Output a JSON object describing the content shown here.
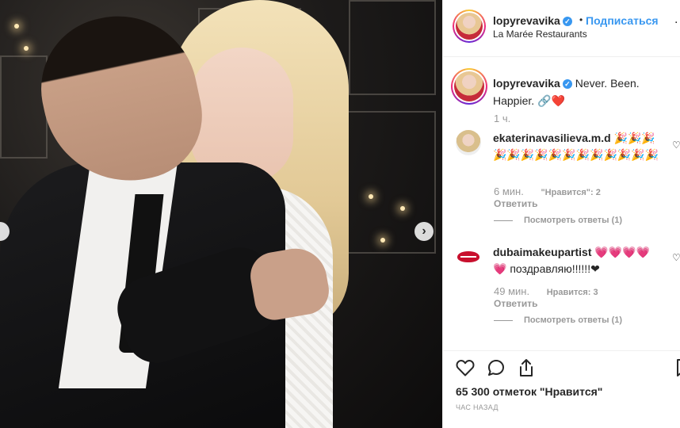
{
  "post": {
    "author": "lopyrevavika",
    "follow_label": "Подписаться",
    "separator": "•",
    "more_label": ".",
    "location": "La Marée Restaurants",
    "caption": "Never. Been. Happier. 🔗❤️",
    "caption_time": "1 ч.",
    "likes": "65 300 отметок \"Нравится\"",
    "time_ago": "ЧАС НАЗАД"
  },
  "comments": [
    {
      "username": "ekaterinavasilieva.m.d",
      "text": "🎉🎉🎉🎉🎉🎉🎉🎉🎉🎉🎉🎉🎉🎉🎉",
      "time": "6 мин.",
      "likes": "\"Нравится\": 2",
      "reply": "Ответить",
      "view_replies": "Посмотреть ответы (1)"
    },
    {
      "username": "dubaimakeupartist",
      "text": "💗💗💗💗💗 поздравляю!!!!!!❤",
      "time": "49 мин.",
      "likes": "Нравится: 3",
      "reply": "Ответить",
      "view_replies": "Посмотреть ответы (1)"
    }
  ],
  "icons": {
    "verified": "verified-badge-icon",
    "like": "heart-outline-icon",
    "comment": "comment-bubble-icon",
    "share": "share-upload-icon",
    "save": "bookmark-icon",
    "next": "chevron-right-icon"
  },
  "colors": {
    "link_blue": "#3897f0",
    "text": "#262626",
    "muted": "#999999",
    "border": "#efefef"
  }
}
